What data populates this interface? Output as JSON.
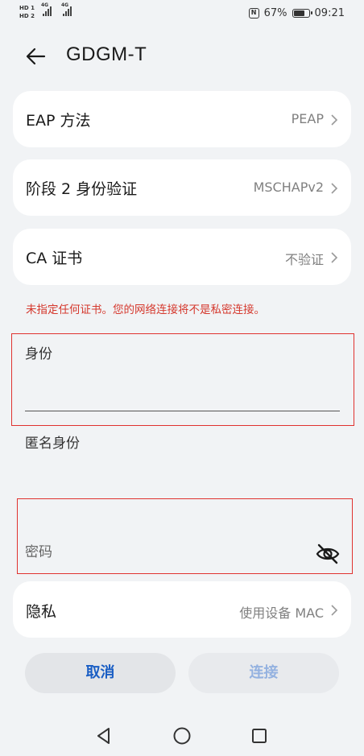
{
  "status_bar": {
    "hd1": "HD 1",
    "hd2": "HD 2",
    "net1": "4G",
    "net2": "4G",
    "battery_percent": "67%",
    "time": "09:21",
    "icons": [
      "nfc-icon",
      "battery-icon",
      "signal-icon"
    ]
  },
  "header": {
    "title": "GDGM-T"
  },
  "settings": [
    {
      "label": "EAP 方法",
      "value": "PEAP"
    },
    {
      "label": "阶段 2 身份验证",
      "value": "MSCHAPv2"
    },
    {
      "label": "CA 证书",
      "value": "不验证"
    }
  ],
  "warning": "未指定任何证书。您的网络连接将不是私密连接。",
  "fields": {
    "identity_label": "身份",
    "identity_value": "",
    "anonymous_label": "匿名身份",
    "anonymous_value": "",
    "password_label": "密码",
    "password_value": ""
  },
  "privacy": {
    "label": "隐私",
    "value": "使用设备 MAC"
  },
  "buttons": {
    "cancel": "取消",
    "connect": "连接"
  },
  "colors": {
    "accent": "#1a5ec4",
    "accent_disabled": "#94b2e0",
    "warning": "#d5382d",
    "background": "#f1f3f5",
    "card": "#ffffff"
  }
}
